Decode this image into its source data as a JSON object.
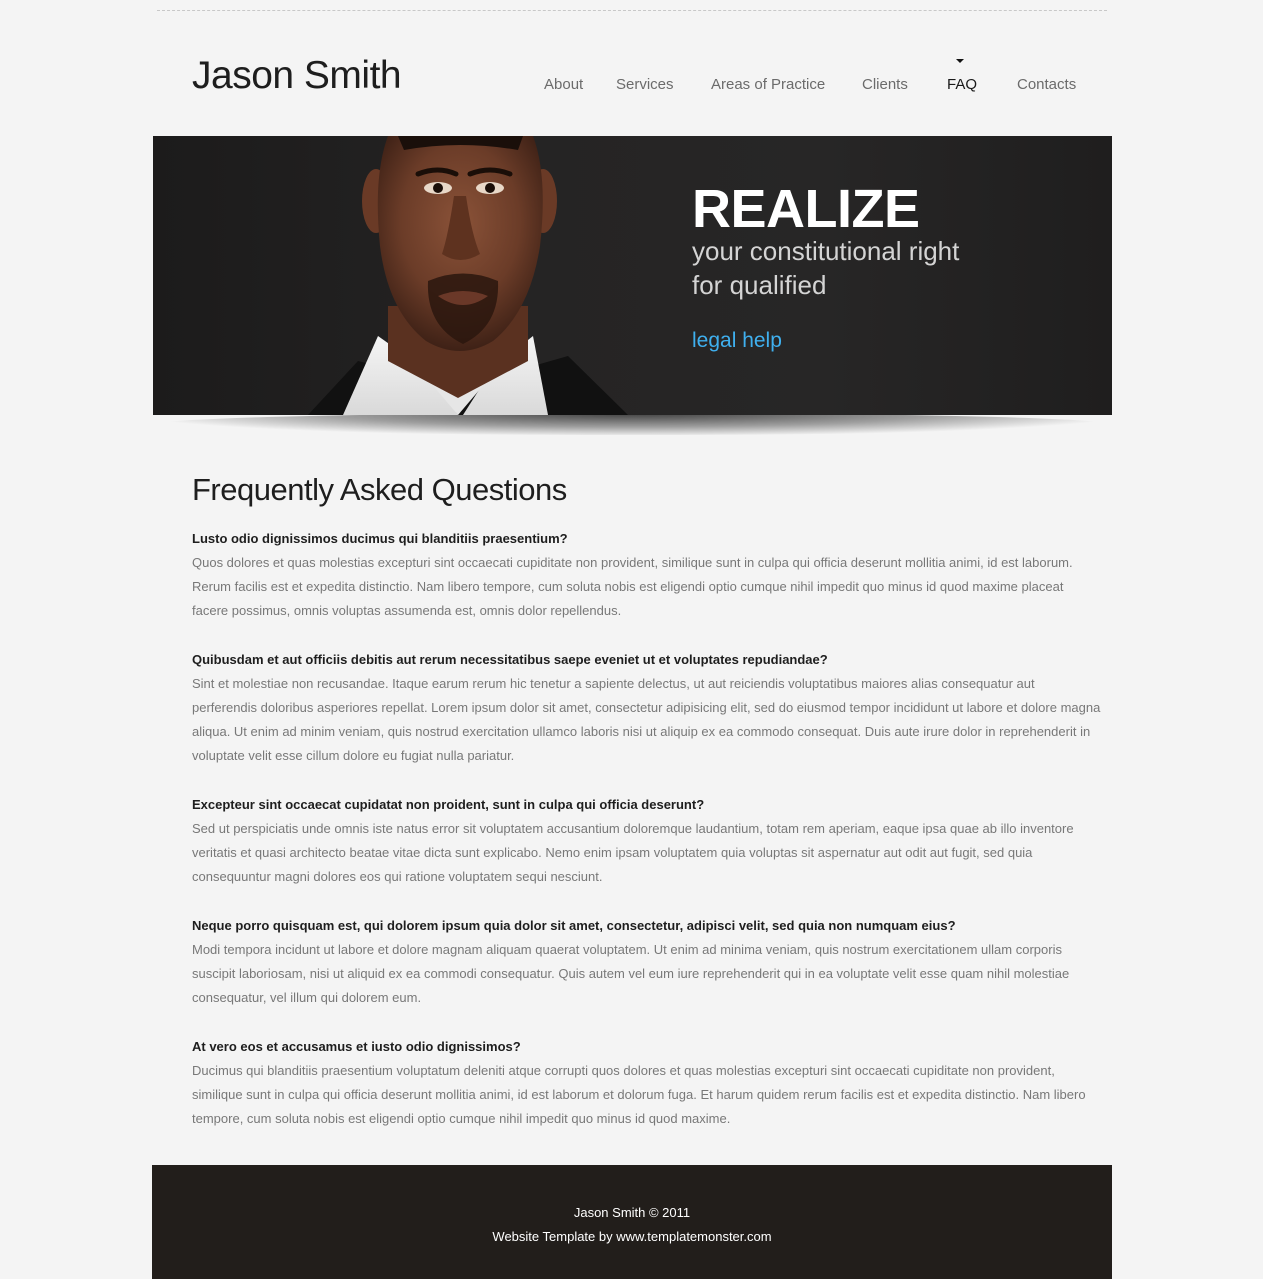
{
  "header": {
    "logo": "Jason Smith"
  },
  "nav": {
    "items": [
      {
        "label": "About"
      },
      {
        "label": "Services"
      },
      {
        "label": "Areas of Practice"
      },
      {
        "label": "Clients"
      },
      {
        "label": "FAQ",
        "active": true
      },
      {
        "label": "Contacts"
      }
    ]
  },
  "hero": {
    "title": "REALIZE",
    "subtitle_line1": "your constitutional right",
    "subtitle_line2": "for qualified",
    "link": "legal help",
    "link_color": "#3fb0ef",
    "background_color": "#222121"
  },
  "main": {
    "title": "Frequently Asked Questions",
    "faqs": [
      {
        "q": "Lusto odio dignissimos ducimus qui blanditiis praesentium?",
        "a": "Quos dolores et quas molestias excepturi sint occaecati cupiditate non provident, similique sunt in culpa qui officia deserunt mollitia animi, id est laborum. Rerum facilis est et expedita distinctio. Nam libero tempore, cum soluta nobis est eligendi optio cumque nihil impedit quo minus id quod maxime placeat facere possimus, omnis voluptas assumenda est, omnis dolor repellendus."
      },
      {
        "q": "Quibusdam et aut officiis debitis aut rerum necessitatibus saepe eveniet ut et voluptates repudiandae?",
        "a": "Sint et molestiae non recusandae. Itaque earum rerum hic tenetur a sapiente delectus, ut aut reiciendis voluptatibus maiores alias consequatur aut perferendis doloribus asperiores repellat. Lorem ipsum dolor sit amet, consectetur adipisicing elit, sed do eiusmod tempor incididunt ut labore et dolore magna aliqua. Ut enim ad minim veniam, quis nostrud exercitation ullamco laboris nisi ut aliquip ex ea commodo consequat. Duis aute irure dolor in reprehenderit in voluptate velit esse cillum dolore eu fugiat nulla pariatur."
      },
      {
        "q": "Excepteur sint occaecat cupidatat non proident, sunt in culpa qui officia deserunt?",
        "a": "Sed ut perspiciatis unde omnis iste natus error sit voluptatem accusantium doloremque laudantium, totam rem aperiam, eaque ipsa quae ab illo inventore veritatis et quasi architecto beatae vitae dicta sunt explicabo. Nemo enim ipsam voluptatem quia voluptas sit aspernatur aut odit aut fugit, sed quia consequuntur magni dolores eos qui ratione voluptatem sequi nesciunt."
      },
      {
        "q": "Neque porro quisquam est, qui dolorem ipsum quia dolor sit amet, consectetur, adipisci velit, sed quia non numquam eius?",
        "a": "Modi tempora incidunt ut labore et dolore magnam aliquam quaerat voluptatem. Ut enim ad minima veniam, quis nostrum exercitationem ullam corporis suscipit laboriosam, nisi ut aliquid ex ea commodi consequatur. Quis autem vel eum iure reprehenderit qui in ea voluptate velit esse quam nihil molestiae consequatur, vel illum qui dolorem eum."
      },
      {
        "q": "At vero eos et accusamus et iusto odio dignissimos?",
        "a": "Ducimus qui blanditiis praesentium voluptatum deleniti atque corrupti quos dolores et quas molestias excepturi sint occaecati cupiditate non provident, similique sunt in culpa qui officia deserunt mollitia animi, id est laborum et dolorum fuga. Et harum quidem rerum facilis est et expedita distinctio. Nam libero tempore, cum soluta nobis est eligendi optio cumque nihil impedit quo minus id quod maxime."
      }
    ]
  },
  "footer": {
    "copyright": "Jason Smith © 2011",
    "credit_prefix": "Website Template by ",
    "credit_link": "www.templatemonster.com"
  }
}
